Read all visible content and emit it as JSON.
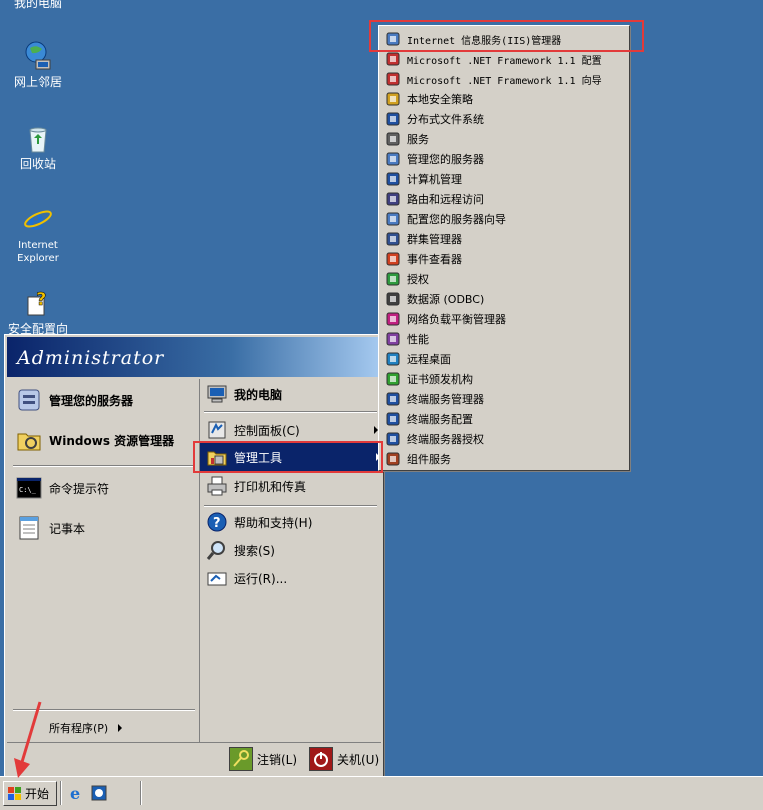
{
  "desktop": {
    "partial_top_label": "我的电脑",
    "icons": [
      {
        "label": "网上邻居",
        "icon": "network-places-icon"
      },
      {
        "label": "回收站",
        "icon": "recycle-bin-icon"
      },
      {
        "label_line1": "Internet",
        "label_line2": "Explorer",
        "icon": "ie-icon"
      },
      {
        "label": "安全配置向",
        "icon": "security-wizard-icon"
      }
    ]
  },
  "start_menu": {
    "user": "Administrator",
    "left": {
      "pinned": [
        {
          "label": "管理您的服务器",
          "icon": "server-manage-icon"
        },
        {
          "label": "Windows 资源管理器",
          "icon": "explorer-icon"
        }
      ],
      "recent": [
        {
          "label": "命令提示符",
          "icon": "cmd-icon"
        },
        {
          "label": "记事本",
          "icon": "notepad-icon"
        }
      ],
      "all_programs": "所有程序(P)"
    },
    "right": {
      "my_computer": "我的电脑",
      "control_panel": "控制面板(C)",
      "admin_tools": "管理工具",
      "printers": "打印机和传真",
      "help": "帮助和支持(H)",
      "search": "搜索(S)",
      "run": "运行(R)..."
    },
    "footer": {
      "logoff": "注销(L)",
      "shutdown": "关机(U)"
    }
  },
  "admin_tools_submenu": [
    {
      "label": "Internet 信息服务(IIS)管理器",
      "icon": "iis-icon",
      "highlighted": true
    },
    {
      "label": "Microsoft .NET Framework 1.1 配置",
      "icon": "dotnet-config-icon"
    },
    {
      "label": "Microsoft .NET Framework 1.1 向导",
      "icon": "dotnet-wizard-icon"
    },
    {
      "label": "本地安全策略",
      "icon": "local-security-icon"
    },
    {
      "label": "分布式文件系统",
      "icon": "dfs-icon"
    },
    {
      "label": "服务",
      "icon": "services-icon"
    },
    {
      "label": "管理您的服务器",
      "icon": "manage-server-icon"
    },
    {
      "label": "计算机管理",
      "icon": "computer-management-icon"
    },
    {
      "label": "路由和远程访问",
      "icon": "routing-icon"
    },
    {
      "label": "配置您的服务器向导",
      "icon": "configure-server-icon"
    },
    {
      "label": "群集管理器",
      "icon": "cluster-icon"
    },
    {
      "label": "事件查看器",
      "icon": "event-viewer-icon"
    },
    {
      "label": "授权",
      "icon": "licensing-icon"
    },
    {
      "label": "数据源 (ODBC)",
      "icon": "odbc-icon"
    },
    {
      "label": "网络负载平衡管理器",
      "icon": "nlb-icon"
    },
    {
      "label": "性能",
      "icon": "performance-icon"
    },
    {
      "label": "远程桌面",
      "icon": "remote-desktop-icon"
    },
    {
      "label": "证书颁发机构",
      "icon": "certificate-icon"
    },
    {
      "label": "终端服务管理器",
      "icon": "ts-manager-icon"
    },
    {
      "label": "终端服务配置",
      "icon": "ts-config-icon"
    },
    {
      "label": "终端服务器授权",
      "icon": "ts-licensing-icon"
    },
    {
      "label": "组件服务",
      "icon": "component-services-icon"
    }
  ],
  "taskbar": {
    "start_label": "开始"
  },
  "colors": {
    "desktop": "#3a6ea5",
    "menu_bg": "#d4d0c8",
    "selection": "#0a246a",
    "annotation": "#e23a3a"
  }
}
